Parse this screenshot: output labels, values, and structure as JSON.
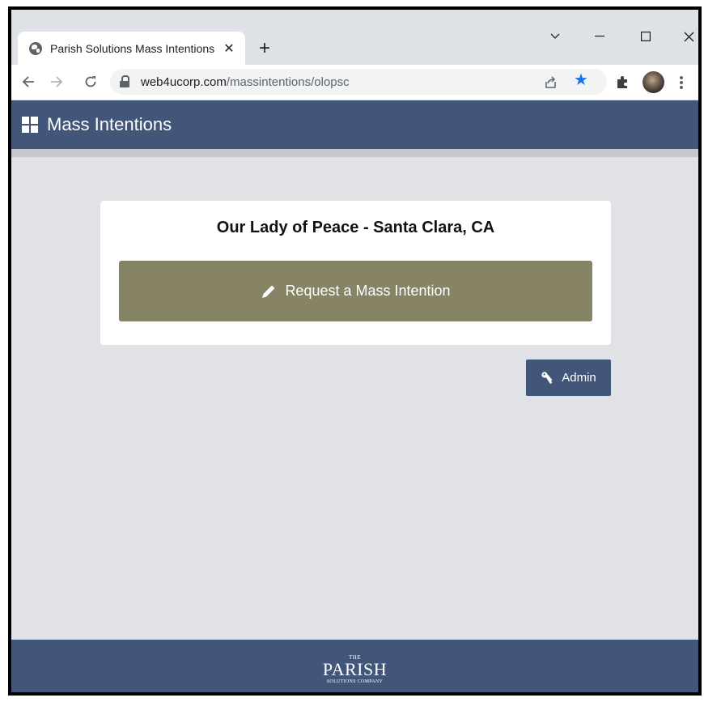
{
  "browser": {
    "tab_title": "Parish Solutions Mass Intentions",
    "tab_close": "✕",
    "new_tab": "+",
    "url_host": "web4ucorp.com",
    "url_path": "/massintentions/olopsc",
    "accent_color": "#1a73e8"
  },
  "app": {
    "title": "Mass Intentions",
    "header_color": "#42567a"
  },
  "card": {
    "parish_name": "Our Lady of Peace - Santa Clara, CA",
    "request_button_label": "Request a Mass Intention",
    "request_button_color": "#878466"
  },
  "admin_button_label": "Admin",
  "footer": {
    "logo_the": "THE",
    "logo_name": "PARISH",
    "logo_company": "SOLUTIONS COMPANY"
  },
  "icons": [
    "globe-icon",
    "close-icon",
    "plus-icon",
    "chevron-down-icon",
    "minimize-icon",
    "maximize-icon",
    "window-close-icon",
    "back-arrow-icon",
    "forward-arrow-icon",
    "reload-icon",
    "lock-icon",
    "share-icon",
    "star-icon",
    "extensions-icon",
    "kebab-menu-icon",
    "grid-icon",
    "pencil-icon",
    "key-icon"
  ]
}
